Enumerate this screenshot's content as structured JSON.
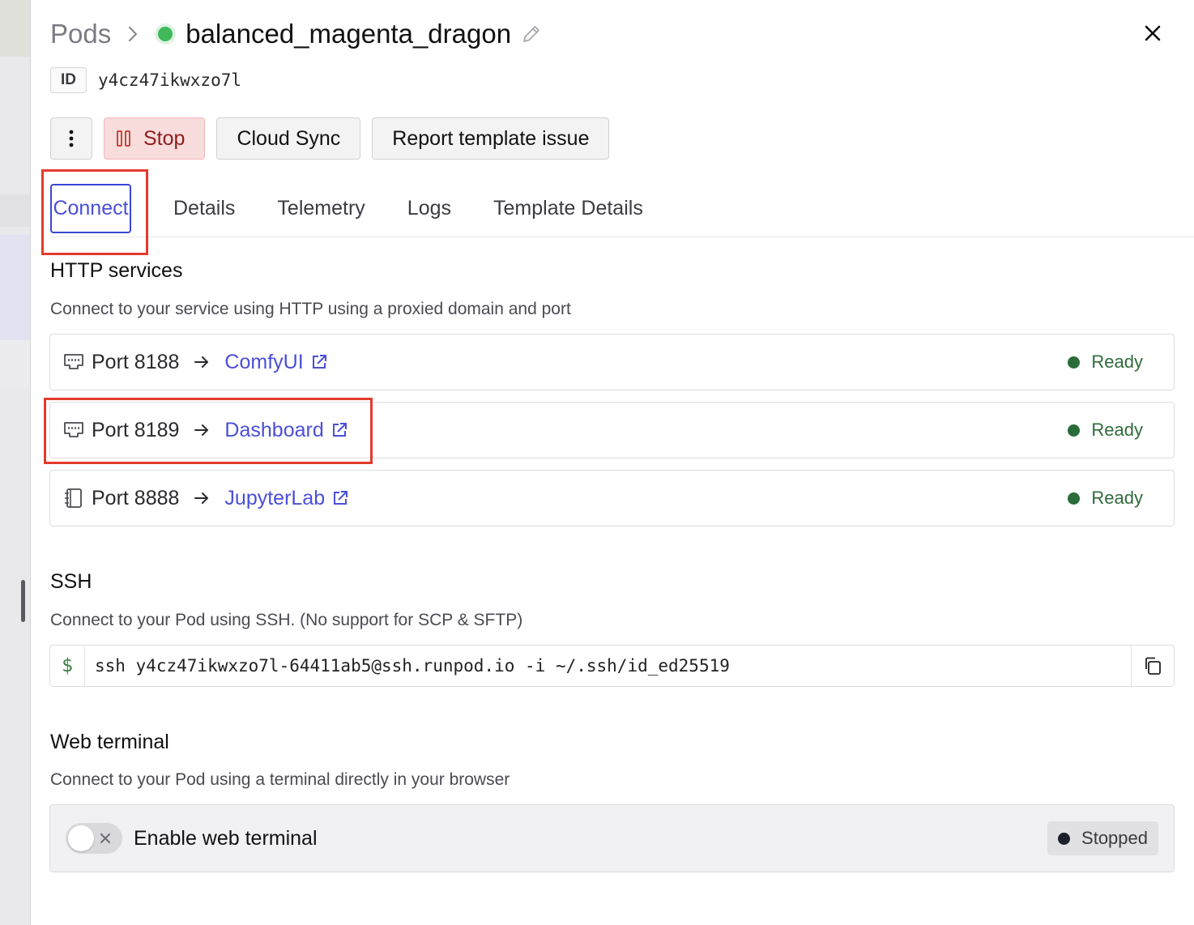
{
  "breadcrumb": {
    "root": "Pods",
    "pod_name": "balanced_magenta_dragon"
  },
  "pod_id": {
    "label": "ID",
    "value": "y4cz47ikwxzo7l"
  },
  "actions": {
    "stop_label": "Stop",
    "cloud_sync_label": "Cloud Sync",
    "report_label": "Report template issue"
  },
  "tabs": [
    {
      "label": "Connect",
      "active": true
    },
    {
      "label": "Details"
    },
    {
      "label": "Telemetry"
    },
    {
      "label": "Logs"
    },
    {
      "label": "Template Details"
    }
  ],
  "http": {
    "title": "HTTP services",
    "description": "Connect to your service using HTTP using a proxied domain and port",
    "services": [
      {
        "port": "Port 8188",
        "name": "ComfyUI",
        "status": "Ready",
        "icon": "ethernet-port-icon"
      },
      {
        "port": "Port 8189",
        "name": "Dashboard",
        "status": "Ready",
        "icon": "ethernet-port-icon"
      },
      {
        "port": "Port 8888",
        "name": "JupyterLab",
        "status": "Ready",
        "icon": "notebook-icon"
      }
    ]
  },
  "ssh": {
    "title": "SSH",
    "description": "Connect to your Pod using SSH. (No support for SCP & SFTP)",
    "prompt": "$",
    "command": "ssh y4cz47ikwxzo7l-64411ab5@ssh.runpod.io -i ~/.ssh/id_ed25519"
  },
  "web_terminal": {
    "title": "Web terminal",
    "description": "Connect to your Pod using a terminal directly in your browser",
    "toggle_label": "Enable web terminal",
    "toggle_on": false,
    "status": "Stopped"
  },
  "colors": {
    "accent": "#4b4fd8",
    "ready_green": "#2a6c3a",
    "running_dot": "#3fb95a",
    "stop_bg": "#f9dcdc",
    "highlight_red": "#e23b2e"
  }
}
